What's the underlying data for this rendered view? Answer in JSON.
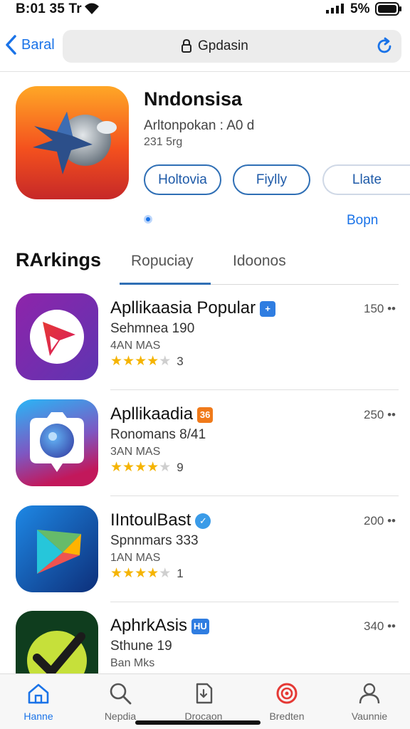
{
  "status": {
    "time": "B:01 35 Tr",
    "battery": "5%"
  },
  "nav": {
    "back_label": "Baral",
    "url": "Gpdasin"
  },
  "app": {
    "title": "Nndonsisa",
    "subtitle": "Arltonpokan : A0 d",
    "meta": "231 5rg",
    "buttons": [
      "Holtovia",
      "Fiylly",
      "Llate"
    ],
    "open_label": "Bopn"
  },
  "section": {
    "title": "RArkings",
    "tabs": [
      "Ropuciay",
      "Idoonos"
    ]
  },
  "items": [
    {
      "name": "Apllikaasia Popular",
      "badge": "+",
      "badge_color": "#2f7de1",
      "sub1": "Sehmnea 190",
      "sub2": "4AN MAS",
      "stars": 4,
      "rating_count": "3",
      "rank": "150 ••"
    },
    {
      "name": "Apllikaadia",
      "badge": "36",
      "badge_color": "#f07a1a",
      "sub1": "Ronomans 8/41",
      "sub2": "3AN MAS",
      "stars": 4,
      "rating_count": "9",
      "rank": "250 ••"
    },
    {
      "name": "IIntoulBast",
      "badge": "✓",
      "badge_color": "#3a9be8",
      "sub1": "Spnnmars 333",
      "sub2": "1AN MAS",
      "stars": 4,
      "rating_count": "1",
      "rank": "200 ••"
    },
    {
      "name": "AphrkAsis",
      "badge": "HU",
      "badge_color": "#2f7de1",
      "sub1": "Sthune 19",
      "sub2": "Ban Mks",
      "stars": 0,
      "rating_count": "",
      "rank": "340 ••"
    }
  ],
  "tabbar": [
    {
      "label": "Hanne",
      "icon": "home-icon"
    },
    {
      "label": "Nepdia",
      "icon": "search-icon"
    },
    {
      "label": "Drocaon",
      "icon": "document-icon"
    },
    {
      "label": "Bredten",
      "icon": "target-icon"
    },
    {
      "label": "Vaunnie",
      "icon": "person-icon"
    }
  ],
  "colors": {
    "accent": "#1a73e8",
    "star": "#f5b400"
  }
}
